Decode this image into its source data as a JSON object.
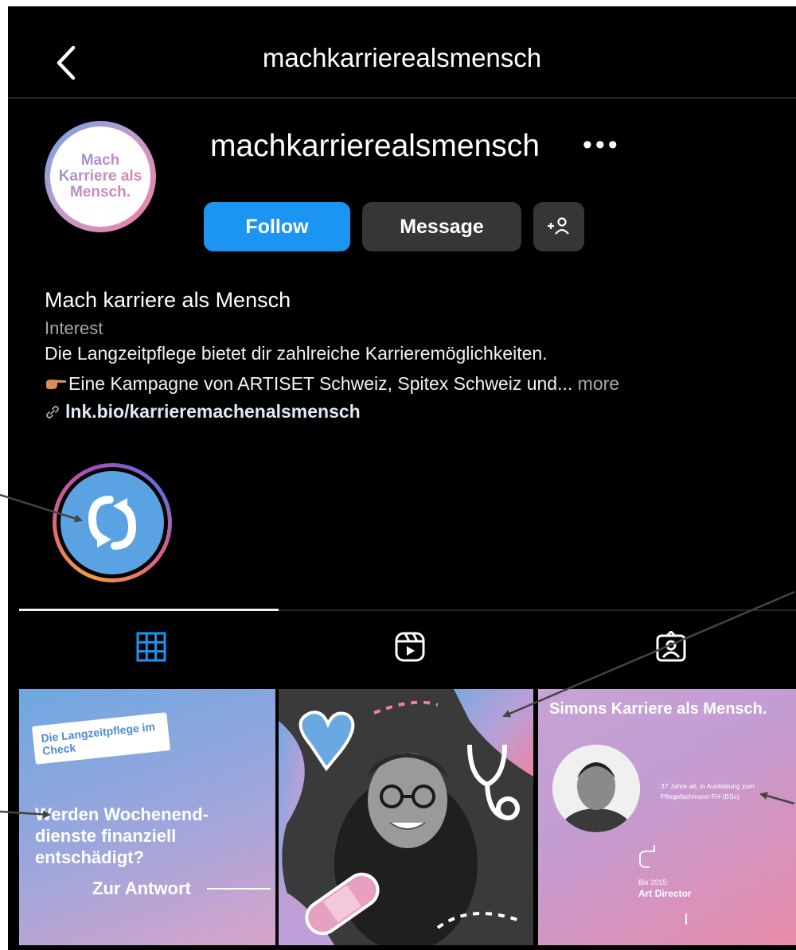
{
  "header": {
    "title": "machkarrierealsmensch"
  },
  "profile": {
    "avatar_text": "Mach Karriere als Mensch.",
    "username": "machkarrierealsmensch",
    "more_label": "•••",
    "follow_label": "Follow",
    "message_label": "Message"
  },
  "bio": {
    "name": "Mach karriere als Mensch",
    "category": "Interest",
    "line1": "Die Langzeitpflege bietet dir zahlreiche Karrieremöglichkeiten.",
    "line2": "Eine Kampagne von ARTISET Schweiz, Spitex Schweiz und...",
    "more": "more",
    "link": "lnk.bio/karrieremachenalsmensch"
  },
  "posts": [
    {
      "badge": "Die Langzeitpflege im Check",
      "question": "Werden Wochenend-dienste finanziell entschädigt?",
      "cta": "Zur Antwort"
    },
    {},
    {
      "title": "Simons Karriere als Mensch.",
      "subtitle": "37 Jahre alt, in Ausbildung zum Pflegefachmann FH (BSc)",
      "since": "Bis 2015:",
      "role": "Art Director"
    }
  ],
  "colors": {
    "follow": "#1c95f2",
    "background": "#000000",
    "button_dark": "#363636"
  }
}
